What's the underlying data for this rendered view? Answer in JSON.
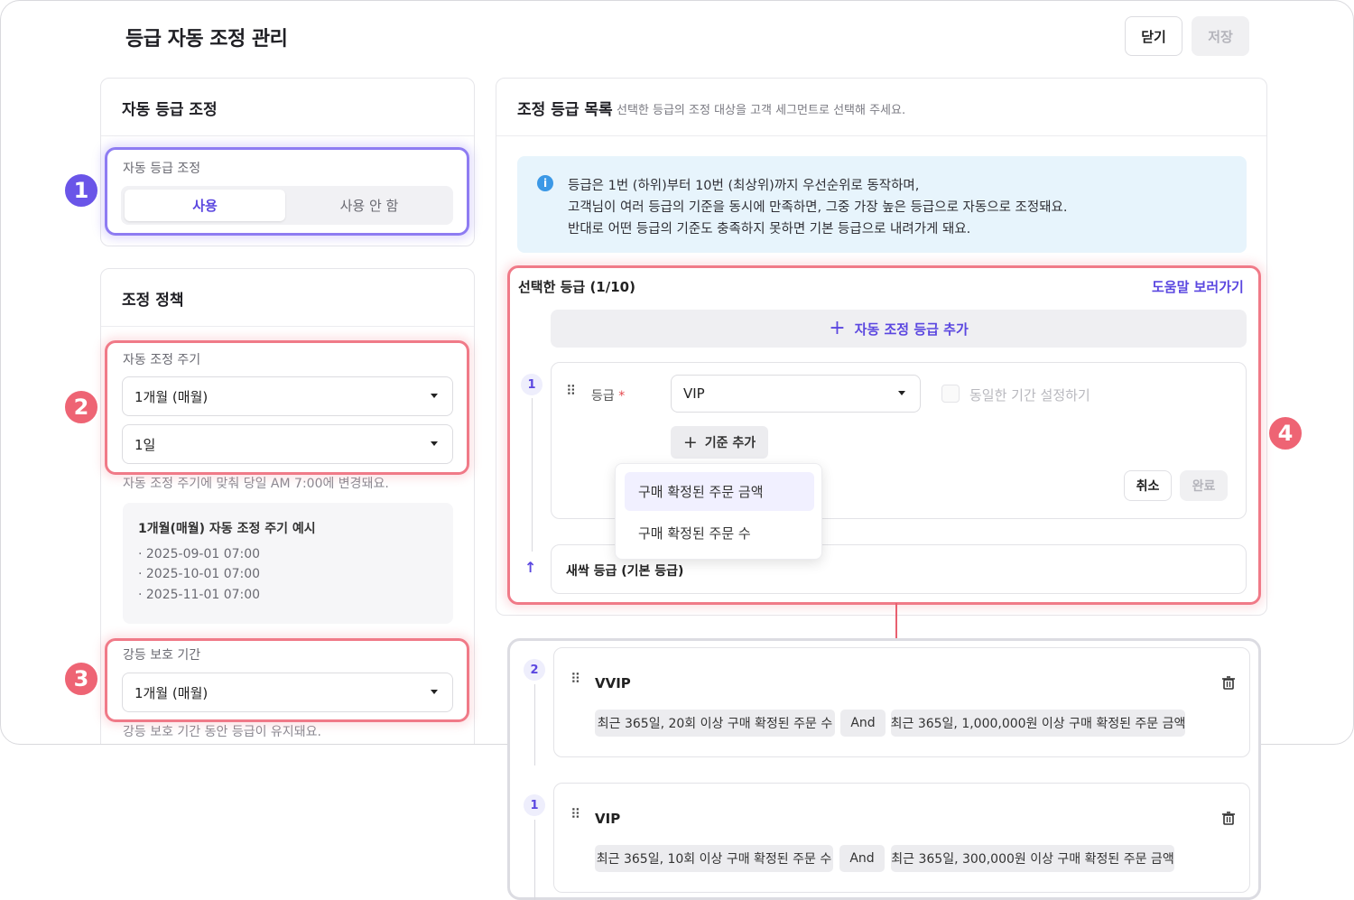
{
  "header": {
    "title": "등급 자동 조정 관리",
    "close_label": "닫기",
    "save_label": "저장"
  },
  "auto_grade": {
    "title": "자동 등급 조정",
    "field_label": "자동 등급 조정",
    "option_on": "사용",
    "option_off": "사용 안 함",
    "selected": "사용"
  },
  "policy": {
    "title": "조정 정책",
    "cycle_label": "자동 조정 주기",
    "cycle_value": "1개월 (매월)",
    "day_value": "1일",
    "cycle_hint": "자동 조정 주기에 맞춰 당일 AM 7:00에 변경돼요.",
    "example_title": "1개월(매월) 자동 조정 주기 예시",
    "example_dates": [
      "· 2025-09-01 07:00",
      "· 2025-10-01 07:00",
      "· 2025-11-01 07:00"
    ],
    "protect_label": "강등 보호 기간",
    "protect_value": "1개월 (매월)",
    "protect_hint": "강등 보호 기간 동안 등급이 유지돼요."
  },
  "grade_list": {
    "title": "조정 등급 목록",
    "subtitle": "선택한 등급의 조정 대상을 고객 세그먼트로 선택해 주세요.",
    "info_lines": [
      "등급은 1번 (하위)부터 10번 (최상위)까지 우선순위로 동작하며,",
      "고객님이 여러 등급의 기준을 동시에 만족하면, 그중 가장 높은 등급으로 자동으로 조정돼요.",
      "반대로 어떤 등급의 기준도 충족하지 못하면 기본 등급으로 내려가게 돼요."
    ],
    "selected_title": "선택한 등급 (1/10)",
    "help_link": "도움말 보러가기",
    "add_grade_label": "자동 조정 등급 추가",
    "edit_card": {
      "order": "1",
      "grade_label": "등급",
      "required_mark": "*",
      "grade_value": "VIP",
      "same_period_label": "동일한 기간 설정하기",
      "add_criteria_label": "기준 추가",
      "cancel_label": "취소",
      "done_label": "완료"
    },
    "dropdown_options": [
      "구매 확정된 주문 금액",
      "구매 확정된 주문 수"
    ],
    "base_grade": "새싹 등급 (기본 등급)"
  },
  "result_cards": [
    {
      "order": "2",
      "name": "VVIP",
      "criteria": [
        "최근 365일, 20회 이상 구매 확정된 주문 수",
        "And",
        "최근 365일, 1,000,000원 이상 구매 확정된 주문 금액"
      ]
    },
    {
      "order": "1",
      "name": "VIP",
      "criteria": [
        "최근 365일, 10회 이상 구매 확정된 주문 수",
        "And",
        "최근 365일, 300,000원 이상 구매 확정된 주문 금액"
      ]
    }
  ],
  "callouts": [
    "1",
    "2",
    "3",
    "4"
  ],
  "colors": {
    "accent": "#5b47e0",
    "highlight_purple": "#8e7cf2",
    "highlight_red": "#f07a88",
    "info_bg": "#e7f4fc"
  }
}
